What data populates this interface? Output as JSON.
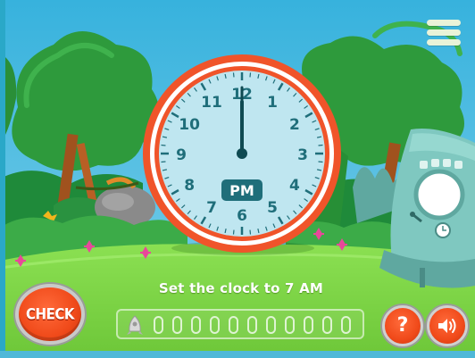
{
  "prompt": {
    "text": "Set the clock to 7 AM"
  },
  "buttons": {
    "check_label": "CHECK",
    "help_glyph": "?"
  },
  "clock": {
    "numbers": [
      "12",
      "1",
      "2",
      "3",
      "4",
      "5",
      "6",
      "7",
      "8",
      "9",
      "10",
      "11"
    ],
    "period_label": "PM",
    "hour": 12,
    "minute": 0
  },
  "progress": {
    "total_slots": 11,
    "filled_slots": 0
  },
  "icons": {
    "menu": "menu-icon",
    "help": "question-icon",
    "sound": "speaker-icon",
    "rocket": "rocket-icon"
  },
  "colors": {
    "sky": "#3bb6df",
    "grass": "#7ed94a",
    "clock_rim": "#f0542a",
    "clock_face": "#bfe6f0",
    "clock_text": "#1f6e7a",
    "button_orange": "#f04a1a"
  }
}
